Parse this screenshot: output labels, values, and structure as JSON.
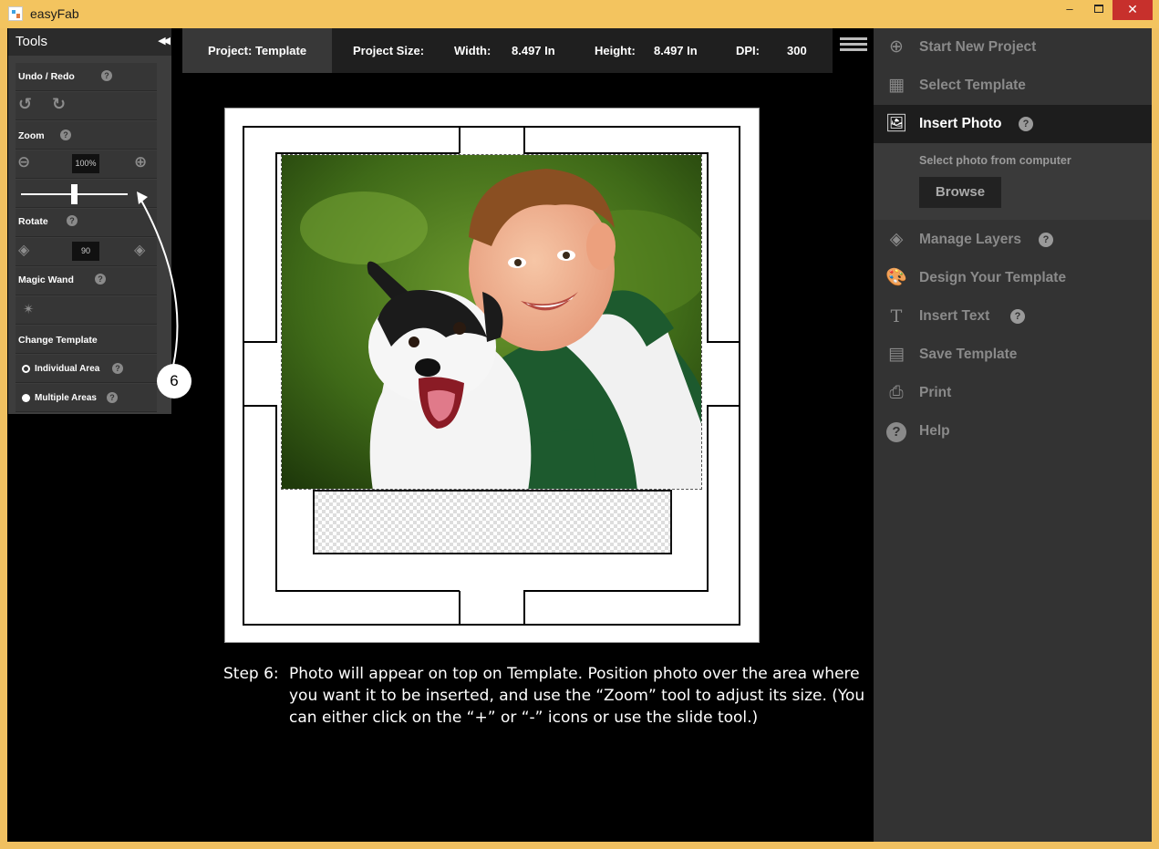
{
  "window": {
    "title": "easyFab",
    "min": "–",
    "close": "✕"
  },
  "tools": {
    "title": "Tools",
    "undo_redo_label": "Undo / Redo",
    "zoom_label": "Zoom",
    "zoom_value": "100%",
    "zoom_slider_level": 0.5,
    "rotate_label": "Rotate",
    "rotate_value": "90",
    "magic_wand_label": "Magic Wand",
    "change_template_label": "Change Template",
    "individual_area_label": "Individual Area",
    "multiple_areas_label": "Multiple Areas",
    "help_glyph": "?"
  },
  "project": {
    "tab": "Project: Template",
    "size_label": "Project Size:",
    "width_label": "Width:",
    "width_value": "8.497 In",
    "height_label": "Height:",
    "height_value": "8.497 In",
    "dpi_label": "DPI:",
    "dpi_value": "300"
  },
  "sidebar": {
    "start_new_project": "Start New Project",
    "select_template": "Select Template",
    "insert_photo": "Insert Photo",
    "insert_photo_desc": "Select photo from computer",
    "browse": "Browse",
    "manage_layers": "Manage Layers",
    "design_template": "Design Your Template",
    "insert_text": "Insert Text",
    "save_template": "Save Template",
    "print": "Print",
    "help": "Help"
  },
  "step": {
    "label": "Step 6:",
    "text": "Photo will appear on top on Template.  Position photo over the area where you want it to be inserted, and use the “Zoom” tool to adjust its size. (You can either click on the “+” or “-” icons or use the slide tool.)"
  },
  "callout": {
    "number": "6"
  },
  "colors": {
    "accent_titlebar": "#f3c45f",
    "close_button": "#c7302c",
    "sidebar_bg": "#333333",
    "active_item": "#1d1d1d"
  }
}
